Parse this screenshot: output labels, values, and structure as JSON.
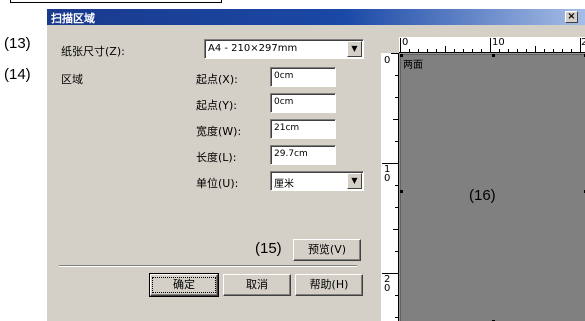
{
  "window": {
    "title": "扫描区域",
    "close_glyph": "×"
  },
  "callouts": {
    "c13": "(13)",
    "c14": "(14)",
    "c15": "(15)",
    "c16": "(16)"
  },
  "paper_size": {
    "label": "纸张尺寸(Z):",
    "value": "A4 - 210×297mm"
  },
  "area": {
    "label": "区域",
    "fields": [
      {
        "label": "起点(X):",
        "value": "0cm"
      },
      {
        "label": "起点(Y):",
        "value": "0cm"
      },
      {
        "label": "宽度(W):",
        "value": "21cm"
      },
      {
        "label": "长度(L):",
        "value": "29.7cm"
      }
    ],
    "unit_label": "单位(U):",
    "unit_value": "厘米"
  },
  "buttons": {
    "preview": "预览(V)",
    "ok": "确定",
    "cancel": "取消",
    "help": "帮助(H)"
  },
  "preview_pane": {
    "ruler_top": [
      "0",
      "10",
      "2"
    ],
    "ruler_left": [
      "0",
      "1\n0",
      "2\n0"
    ],
    "page_label": "两面"
  },
  "colors": {
    "titlebar": "#1a48a6",
    "dialog_bg": "#d4d0c8",
    "page_gray": "#808080"
  }
}
